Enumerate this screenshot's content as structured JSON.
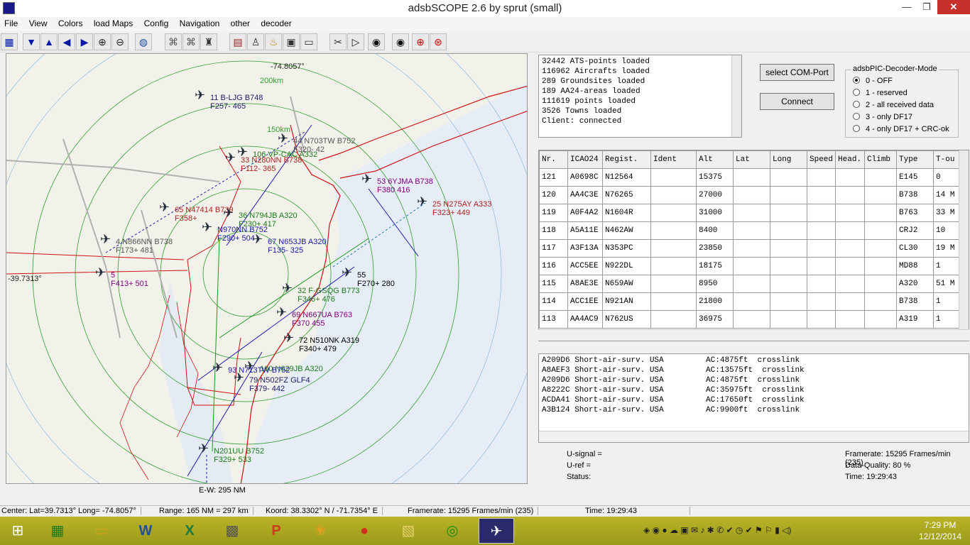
{
  "window": {
    "title": "adsbSCOPE 2.6 by sprut  (small)",
    "minimize": "—",
    "restore": "❐",
    "close": "✕"
  },
  "menu": [
    "File",
    "View",
    "Colors",
    "load Maps",
    "Config",
    "Navigation",
    "other",
    "decoder"
  ],
  "toolbar_icons": [
    "table-icon",
    "arrow-down-icon",
    "arrow-up-icon",
    "arrow-left-icon",
    "arrow-right-icon",
    "zoom-in-icon",
    "zoom-out-icon",
    "globe-icon",
    "network-icon",
    "network2-icon",
    "tower-icon",
    "chart-icon",
    "beacon-icon",
    "alarm-icon",
    "screen-icon",
    "monitor-icon",
    "tools-icon",
    "play-icon",
    "radar-icon",
    "radar2-icon",
    "target-icon",
    "target2-icon"
  ],
  "map": {
    "lon_label": "-74.8057°",
    "lat_label": "-39.7313°",
    "ring_labels": [
      "200km",
      "150km"
    ],
    "ew_label": "E-W: 295 NM",
    "aircraft": [
      {
        "id": "11",
        "call": "B-LJG",
        "type": "B748",
        "alt": "F257- 465",
        "color": "#1a1a6a"
      },
      {
        "id": "44",
        "call": "N703TW",
        "type": "B752",
        "alt": "F320- 42",
        "color": "#555555"
      },
      {
        "id": "106",
        "call": "VP-CAC",
        "type": "A332",
        "alt": "",
        "color": "#1a7a1a"
      },
      {
        "id": "33",
        "call": "N280NN",
        "type": "B738",
        "alt": "F112- 365",
        "color": "#b02020"
      },
      {
        "id": "53",
        "call": "6YJMA",
        "type": "B738",
        "alt": "F380 416",
        "color": "#800080"
      },
      {
        "id": "25",
        "call": "N275AY",
        "type": "A333",
        "alt": "F323+ 449",
        "color": "#b02020"
      },
      {
        "id": "65",
        "call": "N47414",
        "type": "B739",
        "alt": "F358+",
        "color": "#b02020"
      },
      {
        "id": "36",
        "call": "N794JB",
        "type": "A320",
        "alt": "F230+ 417",
        "color": "#1a7a1a"
      },
      {
        "id": "",
        "call": "N970NN",
        "type": "B752",
        "alt": "F290+ 504",
        "color": "#1a1ab0"
      },
      {
        "id": "67",
        "call": "N653JB",
        "type": "A320",
        "alt": "F135- 325",
        "color": "#1a1ab0"
      },
      {
        "id": "4",
        "call": "N866NN",
        "type": "B738",
        "alt": "F173+ 481",
        "color": "#555555"
      },
      {
        "id": "5",
        "call": "",
        "type": "",
        "alt": "F413+ 501",
        "color": "#800080"
      },
      {
        "id": "55",
        "call": "",
        "type": "",
        "alt": "F270+ 280",
        "color": "#000000"
      },
      {
        "id": "32",
        "call": "F-GSQG",
        "type": "B773",
        "alt": "F346+ 476",
        "color": "#1a7a1a"
      },
      {
        "id": "69",
        "call": "N667UA",
        "type": "B763",
        "alt": "F370 455",
        "color": "#800080"
      },
      {
        "id": "72",
        "call": "N510NK",
        "type": "A319",
        "alt": "F340+ 479",
        "color": "#000000"
      },
      {
        "id": "100",
        "call": "N629JB",
        "type": "A320",
        "alt": "",
        "color": "#1a7a1a"
      },
      {
        "id": "93",
        "call": "N713TW",
        "type": "B752",
        "alt": "",
        "color": "#1a1ab0"
      },
      {
        "id": "79",
        "call": "N502FZ",
        "type": "GLF4",
        "alt": "F379- 442",
        "color": "#1a1a6a"
      },
      {
        "id": "",
        "call": "N201UU",
        "type": "B752",
        "alt": "F329+ 533",
        "color": "#1a7a1a"
      }
    ]
  },
  "log": {
    "lines": [
      "32442 ATS-points loaded",
      "116962 Aircrafts loaded",
      "289 Groundsites loaded",
      "189 AA24-areas loaded",
      "111619 points loaded",
      "3526 Towns loaded",
      "Client: connected"
    ]
  },
  "buttons": {
    "com_port": "select COM-Port",
    "connect": "Connect"
  },
  "decoder_mode": {
    "title": "adsbPIC-Decoder-Mode",
    "options": [
      "0 - OFF",
      "1 - reserved",
      "2 - all received data",
      "3 - only DF17",
      "4 - only DF17 + CRC-ok"
    ],
    "selected": 0
  },
  "table": {
    "headers": [
      "Nr.",
      "ICAO24",
      "Regist.",
      "Ident",
      "Alt",
      "Lat",
      "Long",
      "Speed",
      "Head.",
      "Climb",
      "Type",
      "T-ou"
    ],
    "rows": [
      [
        "121",
        "A0698C",
        "N12564",
        "",
        "15375",
        "",
        "",
        "",
        "",
        "",
        "E145",
        "0"
      ],
      [
        "120",
        "AA4C3E",
        "N76265",
        "",
        "27000",
        "",
        "",
        "",
        "",
        "",
        "B738",
        "14 M"
      ],
      [
        "119",
        "A0F4A2",
        "N1604R",
        "",
        "31000",
        "",
        "",
        "",
        "",
        "",
        "B763",
        "33 M"
      ],
      [
        "118",
        "A5A11E",
        "N462AW",
        "",
        "8400",
        "",
        "",
        "",
        "",
        "",
        "CRJ2",
        "10"
      ],
      [
        "117",
        "A3F13A",
        "N353PC",
        "",
        "23850",
        "",
        "",
        "",
        "",
        "",
        "CL30",
        "19 M"
      ],
      [
        "116",
        "ACC5EE",
        "N922DL",
        "",
        "18175",
        "",
        "",
        "",
        "",
        "",
        "MD88",
        "1"
      ],
      [
        "115",
        "A8AE3E",
        "N659AW",
        "",
        "8950",
        "",
        "",
        "",
        "",
        "",
        "A320",
        "51 M"
      ],
      [
        "114",
        "ACC1EE",
        "N921AN",
        "",
        "21800",
        "",
        "",
        "",
        "",
        "",
        "B738",
        "1"
      ],
      [
        "113",
        "AA4AC9",
        "N762US",
        "",
        "36975",
        "",
        "",
        "",
        "",
        "",
        "A319",
        "1"
      ]
    ]
  },
  "messages": {
    "lines": [
      "A209D6 Short-air-surv. USA         AC:4875ft  crosslink",
      "A8AEF3 Short-air-surv. USA         AC:13575ft  crosslink",
      "A209D6 Short-air-surv. USA         AC:4875ft  crosslink",
      "A8222C Short-air-surv. USA         AC:35975ft  crosslink",
      "ACDA41 Short-air-surv. USA         AC:17650ft  crosslink",
      "A3B124 Short-air-surv. USA         AC:9900ft  crosslink"
    ]
  },
  "signal": {
    "u_signal": "U-signal =",
    "u_ref": "U-ref =",
    "status": "Status:",
    "framerate": "Framerate:  15295 Frames/min (235)",
    "quality": "Data-Quality: 80 %",
    "time": "Time: 19:29:43"
  },
  "statusbar": {
    "center": "Center: Lat=39.7313° Long= -74.8057°",
    "range": "Range: 165 NM = 297 km",
    "koord": "Koord: 38.3302° N / -71.7354° E",
    "framerate": "Framerate:  15295 Frames/min (235)",
    "time": "Time: 19:29:43"
  },
  "taskbar": {
    "apps": [
      "⊞",
      "▦",
      "▭",
      "W",
      "X",
      "▩",
      "P",
      "❀",
      "●",
      "▧",
      "◎",
      "✈"
    ],
    "app_names": [
      "windows-start-icon",
      "calculator-icon",
      "file-explorer-icon",
      "word-icon",
      "excel-icon",
      "remote-icon",
      "presentation-icon",
      "paint-icon",
      "chrome-icon",
      "folder-icon",
      "radar-app-icon",
      "adsbscope-icon"
    ],
    "clock_time": "7:29 PM",
    "clock_date": "12/12/2014"
  }
}
